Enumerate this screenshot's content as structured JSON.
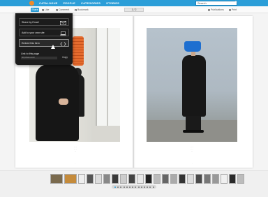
{
  "nav": {
    "items": [
      "CATALOGUE",
      "PEOPLE",
      "CATEGORIES",
      "STORIES"
    ],
    "search_placeholder": "Search"
  },
  "toolbar": {
    "share_label": "Share",
    "items": [
      "Like",
      "Comment",
      "Bookmark",
      "Publications",
      "Print"
    ],
    "pager_value": "1 / 2"
  },
  "share_menu": {
    "items": [
      {
        "label": "Share by Email",
        "icon": "envelope-icon"
      },
      {
        "label": "Add to your own site",
        "icon": "laptop-icon"
      },
      {
        "label": "Embed this item",
        "icon": "embed-code-icon"
      }
    ],
    "link_label": "Link to this page",
    "link_url": "http://issuu.com/",
    "copy_label": "Copy"
  },
  "colors": {
    "nav_blue": "#2b9ed8",
    "logo_orange": "#f08a2a",
    "bucket_blue": "#1e6fd0",
    "lamp_orange": "#e56b2e"
  },
  "thumbnails_count": 22,
  "pagination_dots": 14
}
